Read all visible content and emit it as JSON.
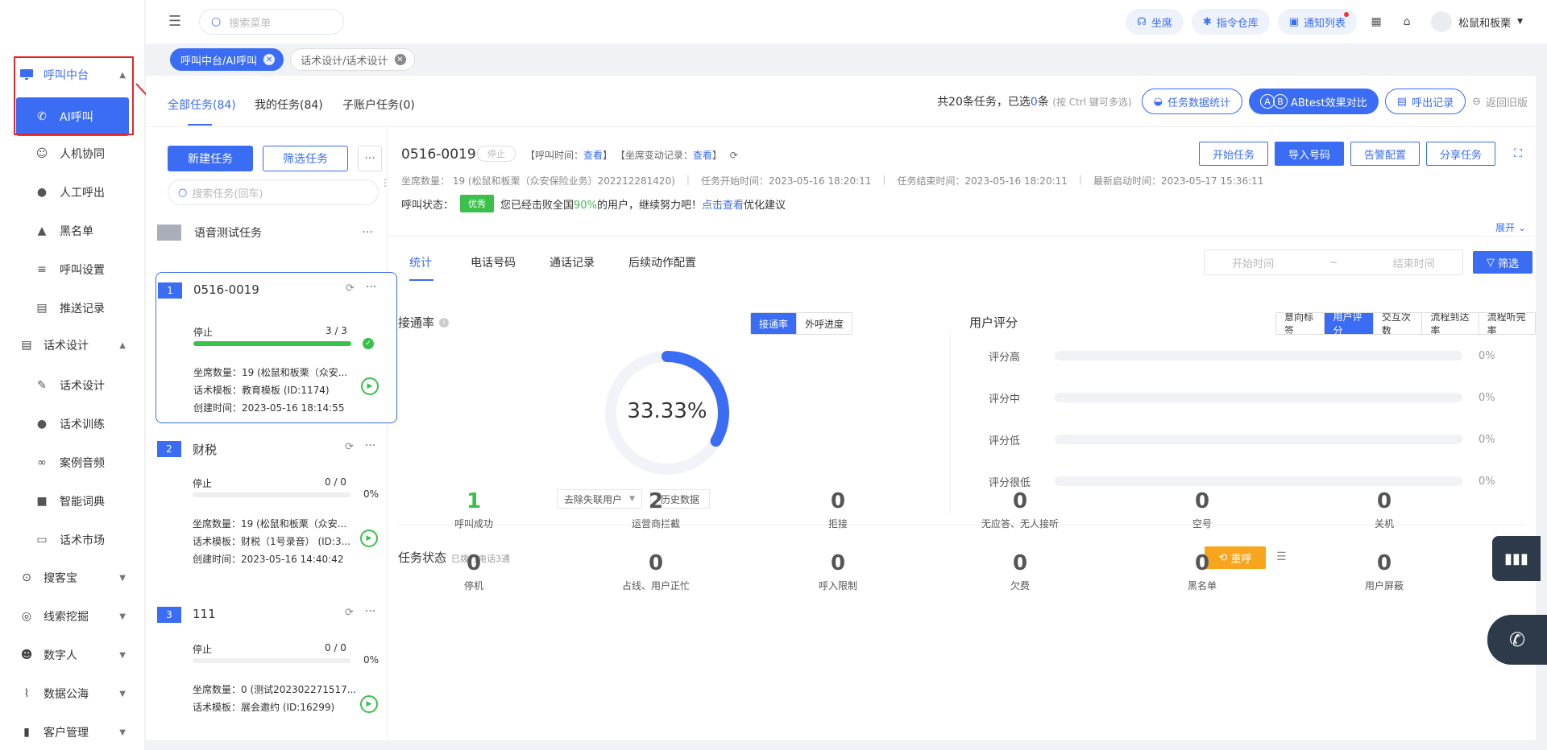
{
  "sidebar": {
    "groups": [
      {
        "label": "呼叫中台",
        "icon": "monitor-icon",
        "expanded": true
      },
      {
        "label": "话术设计",
        "icon": "script-icon",
        "expanded": true
      },
      {
        "label": "搜客宝",
        "icon": "search-customer-icon",
        "expanded": false
      },
      {
        "label": "线索挖掘",
        "icon": "target-icon",
        "expanded": false
      },
      {
        "label": "数字人",
        "icon": "robot-icon",
        "expanded": false
      },
      {
        "label": "数据公海",
        "icon": "chart-icon",
        "expanded": false
      },
      {
        "label": "客户管理",
        "icon": "customer-icon",
        "expanded": false
      }
    ],
    "call_items": [
      {
        "label": "AI呼叫",
        "icon": "phone-icon",
        "active": true
      },
      {
        "label": "人机协同",
        "icon": "user-robot-icon"
      },
      {
        "label": "人工呼出",
        "icon": "person-icon"
      },
      {
        "label": "黑名单",
        "icon": "warning-icon"
      },
      {
        "label": "呼叫设置",
        "icon": "sliders-icon"
      },
      {
        "label": "推送记录",
        "icon": "document-icon"
      }
    ],
    "script_items": [
      {
        "label": "话术设计",
        "icon": "pen-icon"
      },
      {
        "label": "话术训练",
        "icon": "chat-icon"
      },
      {
        "label": "案例音频",
        "icon": "tape-icon"
      },
      {
        "label": "智能词典",
        "icon": "book-icon"
      },
      {
        "label": "话术市场",
        "icon": "market-icon"
      }
    ]
  },
  "header": {
    "search_placeholder": "搜索菜单",
    "pills": [
      {
        "label": "坐席",
        "icon": "headset-icon"
      },
      {
        "label": "指令仓库",
        "icon": "spark-icon"
      },
      {
        "label": "通知列表",
        "icon": "bell-icon",
        "dot": true
      }
    ],
    "user_name": "松鼠和板栗"
  },
  "tagbar": {
    "tags": [
      {
        "label": "呼叫中台/AI呼叫",
        "active": true
      },
      {
        "label": "话术设计/话术设计",
        "active": false
      }
    ]
  },
  "top_tabs": {
    "tabs": [
      "全部任务(84)",
      "我的任务(84)",
      "子账户任务(0)"
    ],
    "summary_pre": "共20条任务，已选",
    "summary_num": "0",
    "summary_post": "条",
    "summary_hint": "(按 Ctrl 键可多选)",
    "btn_stats": "任务数据统计",
    "btn_ab": "ABtest效果对比",
    "btn_ab_a": "A",
    "btn_ab_b": "B",
    "btn_calllog": "呼出记录",
    "back_old": "返回旧版"
  },
  "tasklist": {
    "new_task": "新建任务",
    "filter_task": "筛选任务",
    "more": "···",
    "search_placeholder": "搜索任务(回车)",
    "group_name": "语音测试任务",
    "cards": [
      {
        "num": "1",
        "title": "0516-0019",
        "status": "停止",
        "count": "3 / 3",
        "progress": 1.0,
        "seats": "坐席数量：19 (松鼠和板栗（众安...",
        "template": "话术模板：教育模板 (ID:1174)",
        "created": "创建时间：2023-05-16 18:14:55"
      },
      {
        "num": "2",
        "title": "财税",
        "status": "停止",
        "count": "0 / 0",
        "progress": 0,
        "pct": "0%",
        "seats": "坐席数量：19 (松鼠和板栗（众安...",
        "template": "话术模板：财税（1号录音） (ID:3...",
        "created": "创建时间：2023-05-16 14:40:42"
      },
      {
        "num": "3",
        "title": "111",
        "status": "停止",
        "count": "0 / 0",
        "progress": 0,
        "pct": "0%",
        "seats": "坐席数量：0 (测试202302271517...",
        "template": "话术模板：展会邀约 (ID:16299)"
      }
    ]
  },
  "detail": {
    "title": "0516-0019",
    "stop_badge": "停止",
    "call_time_label": "【呼叫时间：",
    "seat_change_label": "【坐席变动记录：",
    "view": "查看",
    "close_bracket": "】",
    "buttons": [
      "开始任务",
      "导入号码",
      "告警配置",
      "分享任务"
    ],
    "meta": [
      "坐席数量： 19 (松鼠和板栗（众安保险业务）202212281420)",
      "任务开始时间：2023-05-16 18:20:11",
      "任务结束时间：2023-05-16 18:20:11",
      "最新启动时间：2023-05-17 15:36:11"
    ],
    "call_status_label": "呼叫状态：",
    "call_badge": "优秀",
    "call_msg_pre": "您已经击败全国",
    "call_msg_pct": "90%",
    "call_msg_mid": "的用户，继续努力吧！",
    "call_msg_link": "点击查看",
    "call_msg_post": "优化建议",
    "expand": "展开"
  },
  "subtabs": {
    "tabs": [
      "统计",
      "电话号码",
      "通话记录",
      "后续动作配置"
    ],
    "start_placeholder": "开始时间",
    "tilde": "~",
    "end_placeholder": "结束时间",
    "filter": "筛选"
  },
  "connect": {
    "title": "接通率",
    "seg": [
      "接通率",
      "外呼进度"
    ],
    "dropdown": "去除失联用户",
    "history": "历史数据"
  },
  "score": {
    "title": "用户评分",
    "seg": [
      "意向标签",
      "用户评分",
      "交互次数",
      "流程到达率",
      "流程听完率"
    ],
    "rows": [
      {
        "label": "评分高",
        "value": "0%"
      },
      {
        "label": "评分中",
        "value": "0%"
      },
      {
        "label": "评分低",
        "value": "0%"
      },
      {
        "label": "评分很低",
        "value": "0%"
      }
    ]
  },
  "task_status": {
    "title": "任务状态",
    "subtitle": "已拨打电话3通",
    "recall": "重呼",
    "row1": [
      {
        "n": "1",
        "l": "呼叫成功",
        "green": true
      },
      {
        "n": "2",
        "l": "运营商拦截"
      },
      {
        "n": "0",
        "l": "拒接"
      },
      {
        "n": "0",
        "l": "无应答、无人接听"
      },
      {
        "n": "0",
        "l": "空号"
      },
      {
        "n": "0",
        "l": "关机"
      }
    ],
    "row2": [
      {
        "n": "0",
        "l": "停机"
      },
      {
        "n": "0",
        "l": "占线、用户正忙"
      },
      {
        "n": "0",
        "l": "呼入限制"
      },
      {
        "n": "0",
        "l": "欠费"
      },
      {
        "n": "0",
        "l": "黑名单"
      },
      {
        "n": "0",
        "l": "用户屏蔽"
      }
    ]
  },
  "chart_data": {
    "type": "pie",
    "categories": [
      "接通率"
    ],
    "values": [
      33.33
    ],
    "center_label": "33.33%"
  },
  "colors": {
    "accent": "#3a6cf4",
    "success": "#3cc04c",
    "warning": "#f7a51c",
    "annotation": "#e5252a"
  }
}
